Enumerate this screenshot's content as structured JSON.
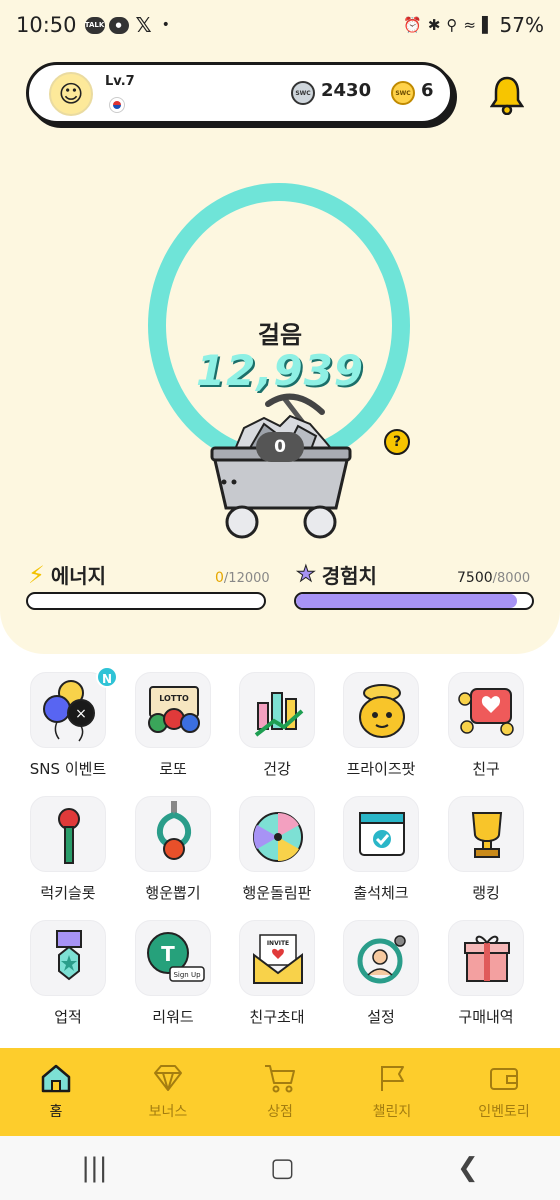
{
  "status_bar": {
    "time": "10:50",
    "talk_label": "TALK",
    "battery": "57%"
  },
  "profile": {
    "level": "Lv.7",
    "coin_silver": "2430",
    "coin_gold": "6",
    "coin_label": "SWC"
  },
  "steps": {
    "label": "걸음",
    "value": "12,939",
    "cart_count": "0",
    "help": "?"
  },
  "energy": {
    "label": "에너지",
    "current": "0",
    "max": "/12000",
    "progress": 0
  },
  "experience": {
    "label": "경험치",
    "current": "7500",
    "max": "/8000",
    "progress": 0.9375
  },
  "menu": [
    {
      "label": "SNS 이벤트",
      "badge": "N"
    },
    {
      "label": "로또",
      "tile_text": "LOTTO"
    },
    {
      "label": "건강"
    },
    {
      "label": "프라이즈팟"
    },
    {
      "label": "친구"
    },
    {
      "label": "럭키슬롯"
    },
    {
      "label": "행운뽑기"
    },
    {
      "label": "행운돌림판"
    },
    {
      "label": "출석체크"
    },
    {
      "label": "랭킹"
    },
    {
      "label": "업적"
    },
    {
      "label": "리워드",
      "tile_text": "Sign Up"
    },
    {
      "label": "친구초대",
      "tile_text": "INVITE"
    },
    {
      "label": "설정"
    },
    {
      "label": "구매내역"
    }
  ],
  "tabs": [
    {
      "label": "홈"
    },
    {
      "label": "보너스"
    },
    {
      "label": "상점"
    },
    {
      "label": "챌린지"
    },
    {
      "label": "인벤토리"
    }
  ],
  "colors": {
    "accent": "#fdcd2c",
    "ring": "#6fe4d8",
    "exp_bar": "#a793f5",
    "header_bg": "#fdf7e0"
  }
}
